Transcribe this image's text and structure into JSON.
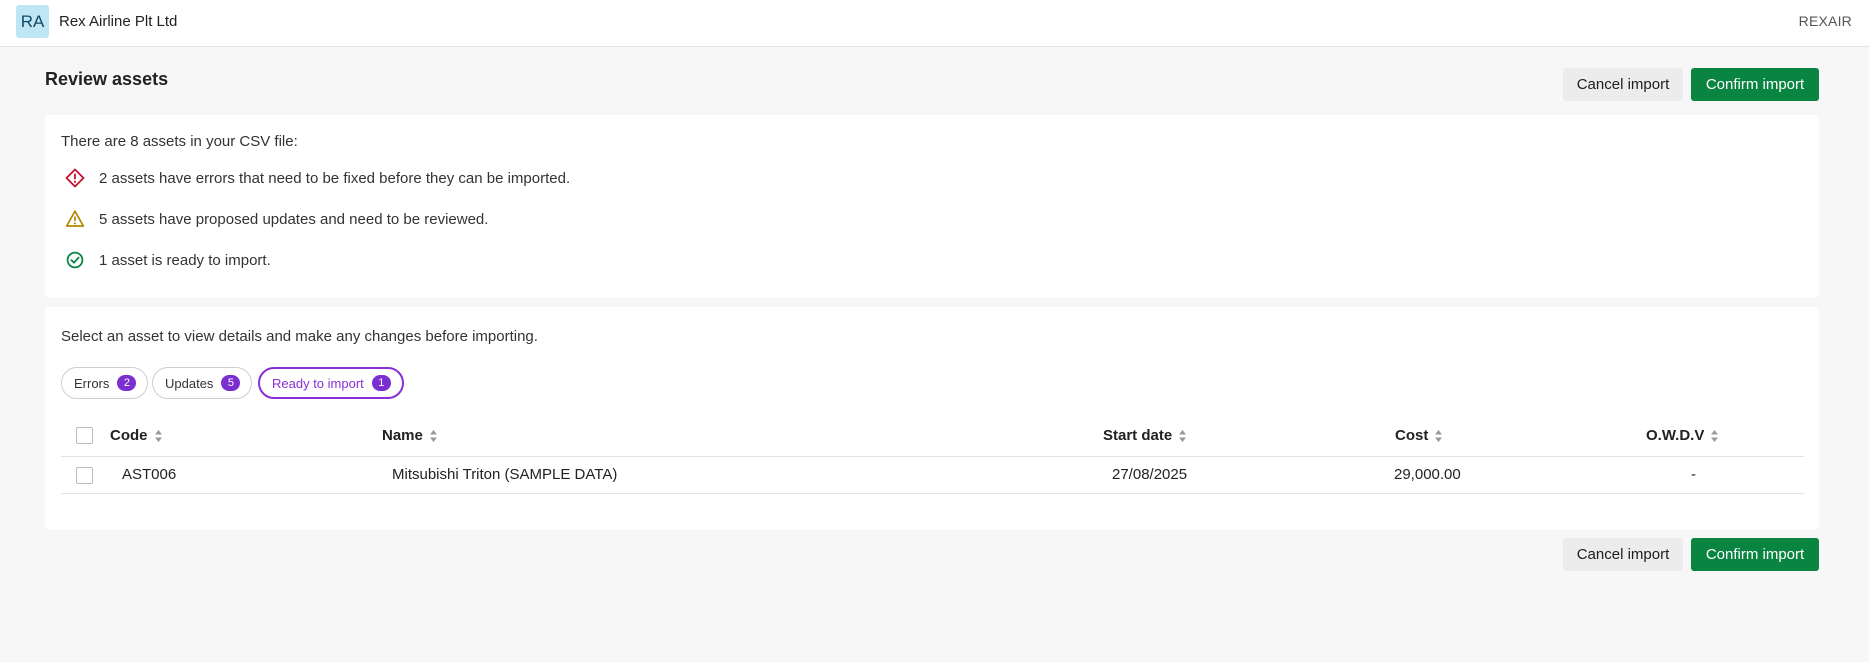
{
  "org": {
    "initials": "RA",
    "name": "Rex Airline Plt Ltd",
    "code": "REXAIR"
  },
  "page": {
    "title": "Review assets"
  },
  "actions": {
    "cancel_label": "Cancel import",
    "confirm_label": "Confirm import"
  },
  "summary": {
    "intro": "There are 8 assets in your CSV file:",
    "errors_text": "2 assets have errors that need to be fixed before they can be imported.",
    "updates_text": "5 assets have proposed updates and need to be reviewed.",
    "ready_text": "1 asset is ready to import."
  },
  "filters": {
    "instructions": "Select an asset to view details and make any changes before importing.",
    "tabs": [
      {
        "label": "Errors",
        "count": "2"
      },
      {
        "label": "Updates",
        "count": "5"
      },
      {
        "label": "Ready to import",
        "count": "1"
      }
    ],
    "active_tab": "Ready to import"
  },
  "table": {
    "columns": [
      "Code",
      "Name",
      "Start date",
      "Cost",
      "O.W.D.V"
    ],
    "rows": [
      {
        "code": "AST006",
        "name": "Mitsubishi Triton (SAMPLE DATA)",
        "start_date": "27/08/2025",
        "cost": "29,000.00",
        "owdv": "-"
      }
    ]
  },
  "colors": {
    "confirm": "#0a8441",
    "error": "#c8102e",
    "warning": "#b08900",
    "success": "#0a8441",
    "accent": "#8a2fd6"
  }
}
